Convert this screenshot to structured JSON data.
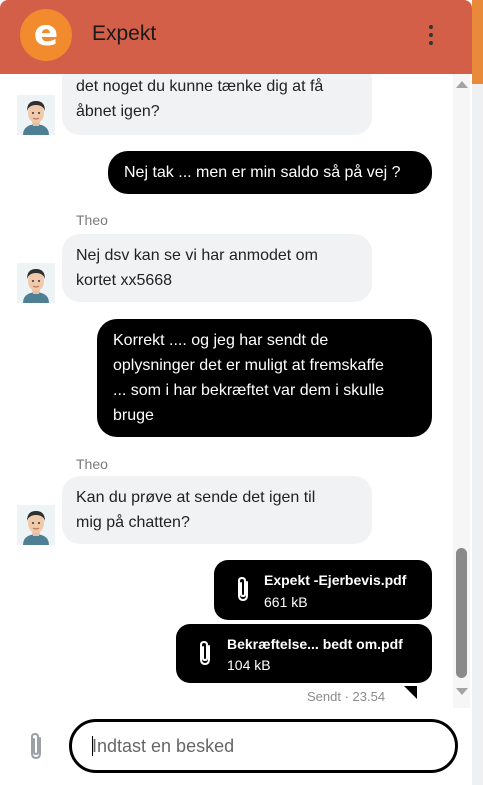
{
  "header": {
    "logo_letter": "e",
    "title": "Expekt",
    "menu_icon": "kebab-menu-icon",
    "color": "#d35f49",
    "logo_color": "#f28a2e"
  },
  "messages": [
    {
      "type": "incoming",
      "lines": [
        "det noget du kunne tænke dig at få",
        "åbnet igen?"
      ]
    },
    {
      "type": "outgoing",
      "lines": [
        "Nej tak ... men er min saldo så på vej ?"
      ]
    },
    {
      "type": "incoming",
      "sender": "Theo",
      "lines": [
        "Nej dsv kan se vi har anmodet om",
        "kortet xx5668"
      ]
    },
    {
      "type": "outgoing",
      "lines": [
        "Korrekt .... og jeg har sendt de",
        "oplysninger det er muligt at fremskaffe",
        "... som i har bekræftet var dem i skulle",
        "bruge"
      ]
    },
    {
      "type": "incoming",
      "sender": "Theo",
      "lines": [
        "Kan du prøve at sende det igen til",
        "mig på chatten?"
      ]
    },
    {
      "type": "file",
      "name": "Expekt -Ejerbevis.pdf",
      "size": "661 kB"
    },
    {
      "type": "file",
      "name": "Bekræftelse... bedt om.pdf",
      "size": "104 kB"
    }
  ],
  "sent_status": "Sendt · 23.54",
  "composer": {
    "placeholder": "Indtast en besked",
    "attach_icon": "paperclip-icon"
  }
}
